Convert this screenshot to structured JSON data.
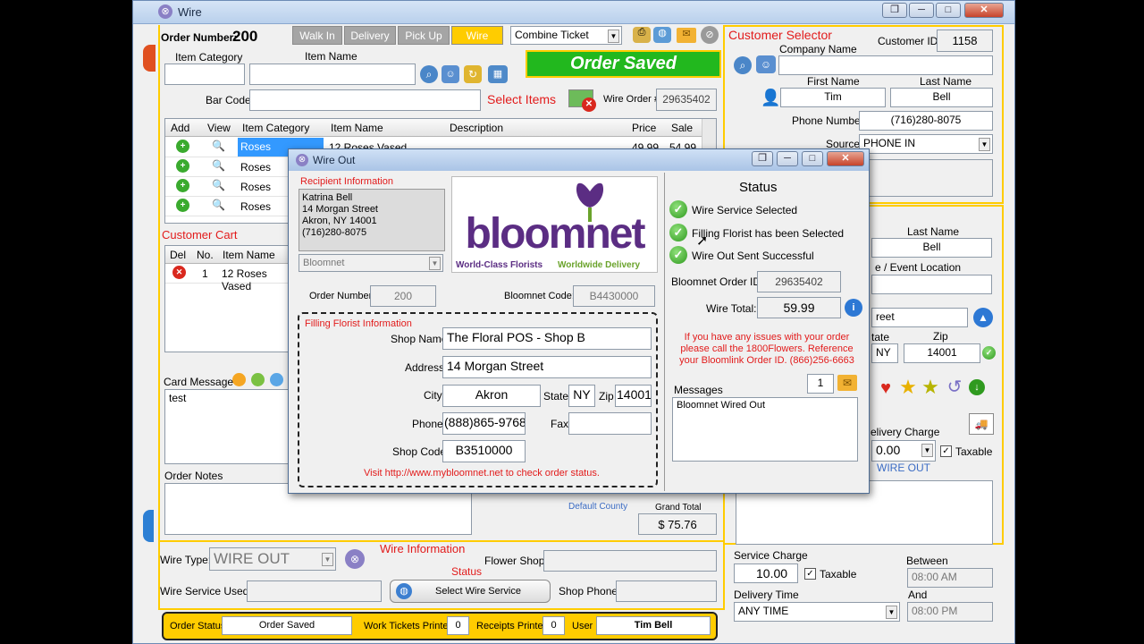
{
  "main_window": {
    "title": "Wire",
    "order_label": "Order Number:",
    "order_number": "200",
    "tabs": [
      {
        "label": "Walk In",
        "active": false
      },
      {
        "label": "Delivery",
        "active": false
      },
      {
        "label": "Pick Up",
        "active": false
      },
      {
        "label": "Wire",
        "active": true
      }
    ],
    "ticket_type": "Combine Ticket",
    "order_saved_banner": "Order Saved",
    "item_category_label": "Item Category",
    "item_name_label": "Item Name",
    "bar_code_label": "Bar Code",
    "select_items_label": "Select Items",
    "wire_order_label": "Wire Order #:",
    "wire_order_value": "29635402"
  },
  "items_grid": {
    "headers": [
      "Add",
      "View",
      "Item Category",
      "Item Name",
      "Description",
      "Price",
      "Sale"
    ],
    "rows": [
      {
        "category": "Roses",
        "name": "12 Roses Vased",
        "price": "49.99",
        "sale": "54.99"
      },
      {
        "category": "Roses",
        "name": "",
        "price": "",
        "sale": ""
      },
      {
        "category": "Roses",
        "name": "",
        "price": "",
        "sale": ""
      },
      {
        "category": "Roses",
        "name": "",
        "price": "",
        "sale": ""
      }
    ]
  },
  "cart": {
    "title": "Customer Cart",
    "headers": [
      "Del",
      "No.",
      "Item Name"
    ],
    "rows": [
      {
        "no": "1",
        "name": "12 Roses Vased"
      }
    ]
  },
  "card_message": {
    "label": "Card Message",
    "text": "test"
  },
  "order_notes": {
    "label": "Order Notes"
  },
  "totals": {
    "default_county": "Default County",
    "grand_total_label": "Grand Total",
    "grand_total": "$ 75.76"
  },
  "wire_info": {
    "title": "Wire Information",
    "status_label": "Status",
    "wire_type_label": "Wire Type:",
    "wire_type": "WIRE OUT",
    "flower_shop_label": "Flower Shop:",
    "wire_service_label": "Wire Service Used:",
    "select_wire_service": "Select Wire Service",
    "shop_phone_label": "Shop Phone:"
  },
  "status_bar": {
    "order_status_label": "Order Status",
    "order_status": "Order Saved",
    "work_tickets_label": "Work Tickets Printed",
    "work_tickets": "0",
    "receipts_label": "Receipts Printed",
    "receipts": "0",
    "user_label": "User",
    "user": "Tim  Bell"
  },
  "customer": {
    "title": "Customer Selector",
    "customer_id_label": "Customer ID",
    "customer_id": "1158",
    "company_label": "Company Name",
    "first_name_label": "First Name",
    "first_name": "Tim",
    "last_name_label": "Last Name",
    "last_name": "Bell",
    "phone_label": "Phone Number",
    "phone": "(716)280-8075",
    "source_label": "Source",
    "source": "PHONE IN"
  },
  "recipient_partial": {
    "last_name_label": "Last Name",
    "last_name": "Bell",
    "location_label": "e / Event Location",
    "street": "reet",
    "state_label": "tate",
    "state": "NY",
    "zip_label": "Zip",
    "zip": "14001"
  },
  "delivery": {
    "delivery_charge_label": "elivery Charge",
    "delivery_charge": "0.00",
    "taxable_label": "Taxable",
    "wire_out_label": "WIRE OUT",
    "service_charge_label": "Service Charge",
    "service_charge": "10.00",
    "service_taxable_label": "Taxable",
    "between_label": "Between",
    "between": "08:00 AM",
    "and_label": "And",
    "and": "08:00 PM",
    "delivery_time_label": "Delivery Time",
    "delivery_time": "ANY TIME"
  },
  "wire_out_dialog": {
    "title": "Wire Out",
    "recipient_title": "Recipient Information",
    "recipient_lines": [
      "Katrina Bell",
      "14 Morgan Street",
      "Akron, NY 14001",
      "(716)280-8075"
    ],
    "service_select": "Bloomnet",
    "logo_word": "bloomnet",
    "logo_tagline_left": "World-Class Florists",
    "logo_tagline_right": "Worldwide Delivery",
    "order_number_label": "Order Number:",
    "order_number": "200",
    "bloomnet_code_label": "Bloomnet Code:",
    "bloomnet_code": "B4430000",
    "filling_title": "Filling Florist Information",
    "shop_name_label": "Shop Name",
    "shop_name": "The Floral POS - Shop B",
    "address_label": "Address",
    "address": "14 Morgan Street",
    "city_label": "City",
    "city": "Akron",
    "state_label": "State",
    "state": "NY",
    "zip_label": "Zip",
    "zip": "14001",
    "phone_label": "Phone",
    "phone": "(888)865-9768",
    "fax_label": "Fax",
    "shop_code_label": "Shop Code",
    "shop_code": "B3510000",
    "visit_text": "Visit http://www.mybloomnet.net to check order status.",
    "status_title": "Status",
    "status_items": [
      "Wire Service Selected",
      "Filling Florist has been Selected",
      "Wire Out Sent Successful"
    ],
    "order_id_label": "Bloomnet Order ID:",
    "order_id": "29635402",
    "wire_total_label": "Wire Total:",
    "wire_total": "59.99",
    "issues_text": "If you have any issues with your order please call the 1800Flowers. Reference your Bloomlink Order ID. (866)256-6663",
    "messages_label": "Messages",
    "messages_count": "1",
    "message_text": "Bloomnet Wired Out"
  },
  "colors": {
    "accent_yellow": "#ffcc00",
    "banner_green": "#22b81e",
    "label_red": "#e21b1b",
    "logo_purple": "#5b2d83",
    "logo_green": "#6aa32b"
  }
}
